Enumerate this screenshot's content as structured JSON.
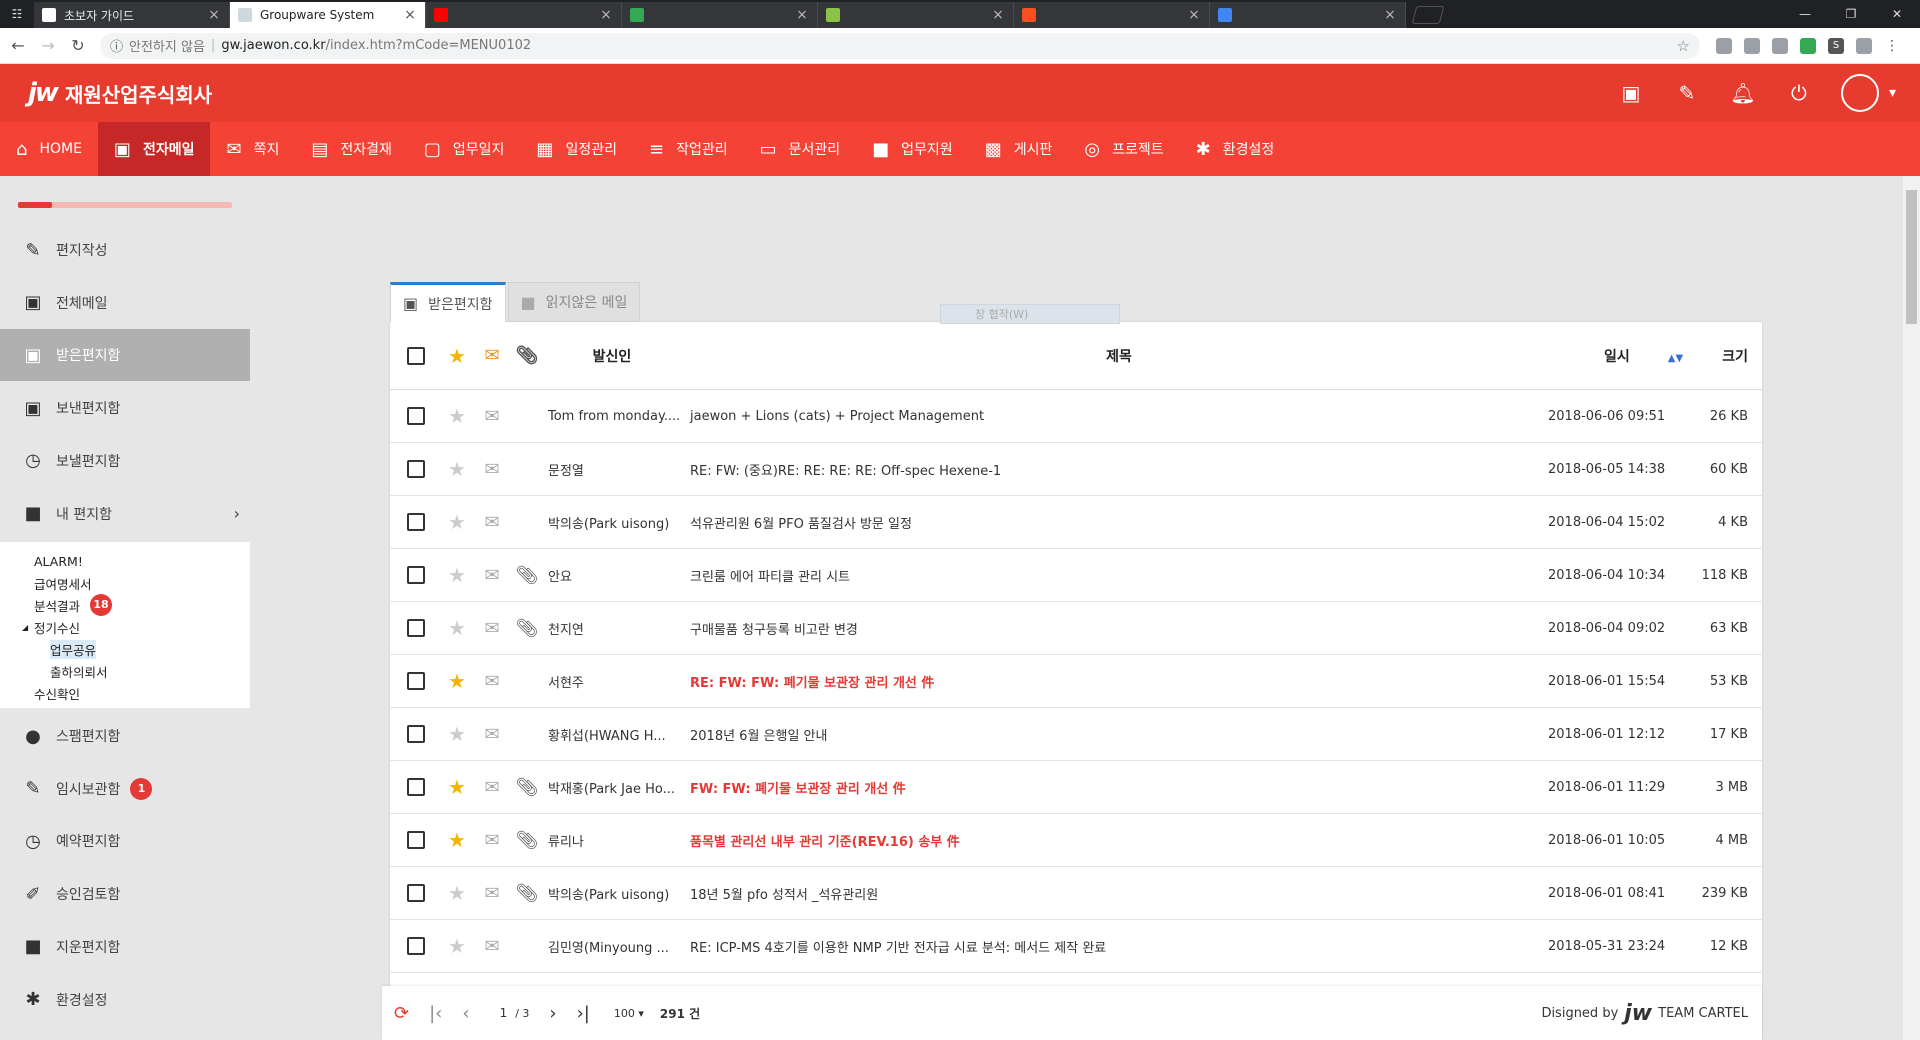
{
  "browser": {
    "tabs": [
      {
        "label": "초보자 가이드",
        "fav": "#ffffff"
      },
      {
        "label": "Groupware System",
        "fav": "#cfd8dc"
      },
      {
        "label": "",
        "fav": "#ff0000"
      },
      {
        "label": "",
        "fav": "#34a853"
      },
      {
        "label": "",
        "fav": "#8bc34a"
      },
      {
        "label": "",
        "fav": "#f4511e"
      },
      {
        "label": "",
        "fav": "#4285f4"
      }
    ],
    "security": "안전하지 않음",
    "host": "gw.jaewon.co.kr",
    "path": "/index.htm?mCode=MENU0102"
  },
  "header": {
    "logo_mark": "jw",
    "company": "재원산업주식회사"
  },
  "menu": [
    {
      "label": "HOME",
      "icon": "home-icon",
      "glyph": "⌂"
    },
    {
      "label": "전자메일",
      "icon": "inbox-icon",
      "glyph": "▣",
      "active": true
    },
    {
      "label": "쪽지",
      "icon": "envelope-icon",
      "glyph": "✉"
    },
    {
      "label": "전자결재",
      "icon": "document-icon",
      "glyph": "▤"
    },
    {
      "label": "업무일지",
      "icon": "clipboard-icon",
      "glyph": "▢"
    },
    {
      "label": "일정관리",
      "icon": "calendar-icon",
      "glyph": "▦"
    },
    {
      "label": "작업관리",
      "icon": "list-icon",
      "glyph": "≡"
    },
    {
      "label": "문서관리",
      "icon": "monitor-icon",
      "glyph": "▭"
    },
    {
      "label": "업무지원",
      "icon": "briefcase-icon",
      "glyph": "■"
    },
    {
      "label": "게시판",
      "icon": "board-icon",
      "glyph": "▩"
    },
    {
      "label": "프로젝트",
      "icon": "project-icon",
      "glyph": "◎"
    },
    {
      "label": "환경설정",
      "icon": "gear-icon",
      "glyph": "✱"
    }
  ],
  "sidebar": {
    "items": [
      {
        "label": "편지작성",
        "glyph": "✎",
        "icon": "pencil-icon"
      },
      {
        "label": "전체메일",
        "glyph": "▣",
        "icon": "all-mail-icon"
      },
      {
        "label": "받은편지함",
        "glyph": "▣",
        "icon": "inbox-icon",
        "active": true
      },
      {
        "label": "보낸편지함",
        "glyph": "▣",
        "icon": "sent-icon"
      },
      {
        "label": "보낼편지함",
        "glyph": "◷",
        "icon": "timer-icon"
      },
      {
        "label": "내 편지함",
        "glyph": "■",
        "icon": "folder-icon",
        "arrow": "›"
      }
    ],
    "tree": [
      {
        "label": "ALARM!",
        "level": 0
      },
      {
        "label": "급여명세서",
        "level": 0
      },
      {
        "label": "분석결과",
        "level": 0,
        "badge": "18"
      },
      {
        "label": "정기수신",
        "level": 0,
        "caret": "◢"
      },
      {
        "label": "업무공유",
        "level": 1,
        "selected": true
      },
      {
        "label": "출하의뢰서",
        "level": 1
      },
      {
        "label": "수신확인",
        "level": 0
      }
    ],
    "items2": [
      {
        "label": "스팸편지함",
        "glyph": "●",
        "icon": "spam-icon"
      },
      {
        "label": "임시보관함",
        "glyph": "✎",
        "icon": "draft-icon",
        "badge": "1"
      },
      {
        "label": "예약편지함",
        "glyph": "◷",
        "icon": "clock-icon"
      },
      {
        "label": "승인검토함",
        "glyph": "✐",
        "icon": "brush-icon"
      },
      {
        "label": "지운편지함",
        "glyph": "■",
        "icon": "trash-icon"
      },
      {
        "label": "환경설정",
        "glyph": "✱",
        "icon": "gear-icon"
      }
    ],
    "progress": 0.16
  },
  "mailbox": {
    "tabs": [
      {
        "label": "받은편지함",
        "active": true
      },
      {
        "label": "읽지않은 메일",
        "active": false
      }
    ],
    "ghost_text": "장 협작(W)",
    "columns": {
      "from": "발신인",
      "subject": "제목",
      "date": "일시",
      "size": "크기"
    },
    "rows": [
      {
        "star": false,
        "clip": false,
        "from": "Tom from monday....",
        "subject": "jaewon + Lions (cats) + Project Management",
        "red": false,
        "date": "2018-06-06 09:51",
        "size": "26 KB"
      },
      {
        "star": false,
        "clip": false,
        "from": "문정열",
        "subject": "RE: FW: (중요)RE: RE: RE: RE: Off-spec Hexene-1",
        "red": false,
        "date": "2018-06-05 14:38",
        "size": "60 KB"
      },
      {
        "star": false,
        "clip": false,
        "from": "박의송(Park uisong)",
        "subject": "석유관리원 6월 PFO 품질검사 방문 일정",
        "red": false,
        "date": "2018-06-04 15:02",
        "size": "4 KB"
      },
      {
        "star": false,
        "clip": true,
        "from": "안요",
        "subject": "크린룸 에어 파티클 관리 시트",
        "red": false,
        "date": "2018-06-04 10:34",
        "size": "118 KB"
      },
      {
        "star": false,
        "clip": true,
        "from": "천지연",
        "subject": "구매물품 청구등록 비고란 변경",
        "red": false,
        "date": "2018-06-04 09:02",
        "size": "63 KB"
      },
      {
        "star": true,
        "clip": false,
        "from": "서현주",
        "subject": "RE: FW: FW: 폐기물 보관장 관리 개선 件",
        "red": true,
        "date": "2018-06-01 15:54",
        "size": "53 KB"
      },
      {
        "star": false,
        "clip": false,
        "from": "황휘섭(HWANG H...",
        "subject": "2018년 6월 은행일 안내",
        "red": false,
        "date": "2018-06-01 12:12",
        "size": "17 KB"
      },
      {
        "star": true,
        "clip": true,
        "from": "박재홍(Park Jae Ho...",
        "subject": "FW: FW: 폐기물 보관장 관리 개선 件",
        "red": true,
        "date": "2018-06-01 11:29",
        "size": "3 MB"
      },
      {
        "star": true,
        "clip": true,
        "from": "류리나",
        "subject": "품목별 관리선 내부 관리 기준(REV.16) 송부 件",
        "red": true,
        "date": "2018-06-01 10:05",
        "size": "4 MB"
      },
      {
        "star": false,
        "clip": true,
        "from": "박의송(Park uisong)",
        "subject": "18년 5월 pfo 성적서 _석유관리원",
        "red": false,
        "date": "2018-06-01 08:41",
        "size": "239 KB"
      },
      {
        "star": false,
        "clip": false,
        "from": "김민영(Minyoung ...",
        "subject": "RE: ICP-MS 4호기를 이용한 NMP 기반 전자급 시료 분석: 메서드 제작 완료",
        "red": false,
        "date": "2018-05-31 23:24",
        "size": "12 KB"
      }
    ]
  },
  "pager": {
    "page": "1",
    "total_pages": "/ 3",
    "per_page": "100 ▾",
    "count": "291 건",
    "designed_by": "Disigned by",
    "team": "TEAM CARTEL"
  }
}
